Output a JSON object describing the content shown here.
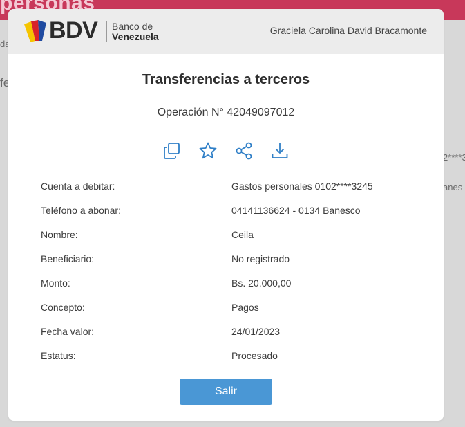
{
  "background": {
    "banner_title": "personas",
    "fragments": [
      "da",
      "fe",
      "2****3",
      "anes"
    ]
  },
  "header": {
    "brand": "BDV",
    "brand_sub_line1": "Banco de",
    "brand_sub_line2": "Venezuela",
    "user_name": "Graciela Carolina David Bracamonte"
  },
  "modal": {
    "title": "Transferencias a terceros",
    "operation": "Operación N° 42049097012",
    "actions": [
      {
        "name": "copy-icon"
      },
      {
        "name": "star-icon"
      },
      {
        "name": "share-icon"
      },
      {
        "name": "download-icon"
      }
    ],
    "details": [
      {
        "label": "Cuenta a debitar:",
        "value": "Gastos personales 0102****3245"
      },
      {
        "label": "Teléfono a abonar:",
        "value": "04141136624 - 0134 Banesco"
      },
      {
        "label": "Nombre:",
        "value": "Ceila"
      },
      {
        "label": "Beneficiario:",
        "value": "No registrado"
      },
      {
        "label": "Monto:",
        "value": "Bs. 20.000,00"
      },
      {
        "label": "Concepto:",
        "value": "Pagos"
      },
      {
        "label": "Fecha valor:",
        "value": "24/01/2023"
      },
      {
        "label": "Estatus:",
        "value": "Procesado"
      }
    ],
    "exit_label": "Salir"
  },
  "colors": {
    "primary_button": "#4a97d5",
    "icon_blue": "#2f7fc7",
    "banner": "#c8385a",
    "logo_yellow": "#f5c400",
    "logo_red": "#d8232a",
    "logo_blue": "#1f4aa0"
  }
}
